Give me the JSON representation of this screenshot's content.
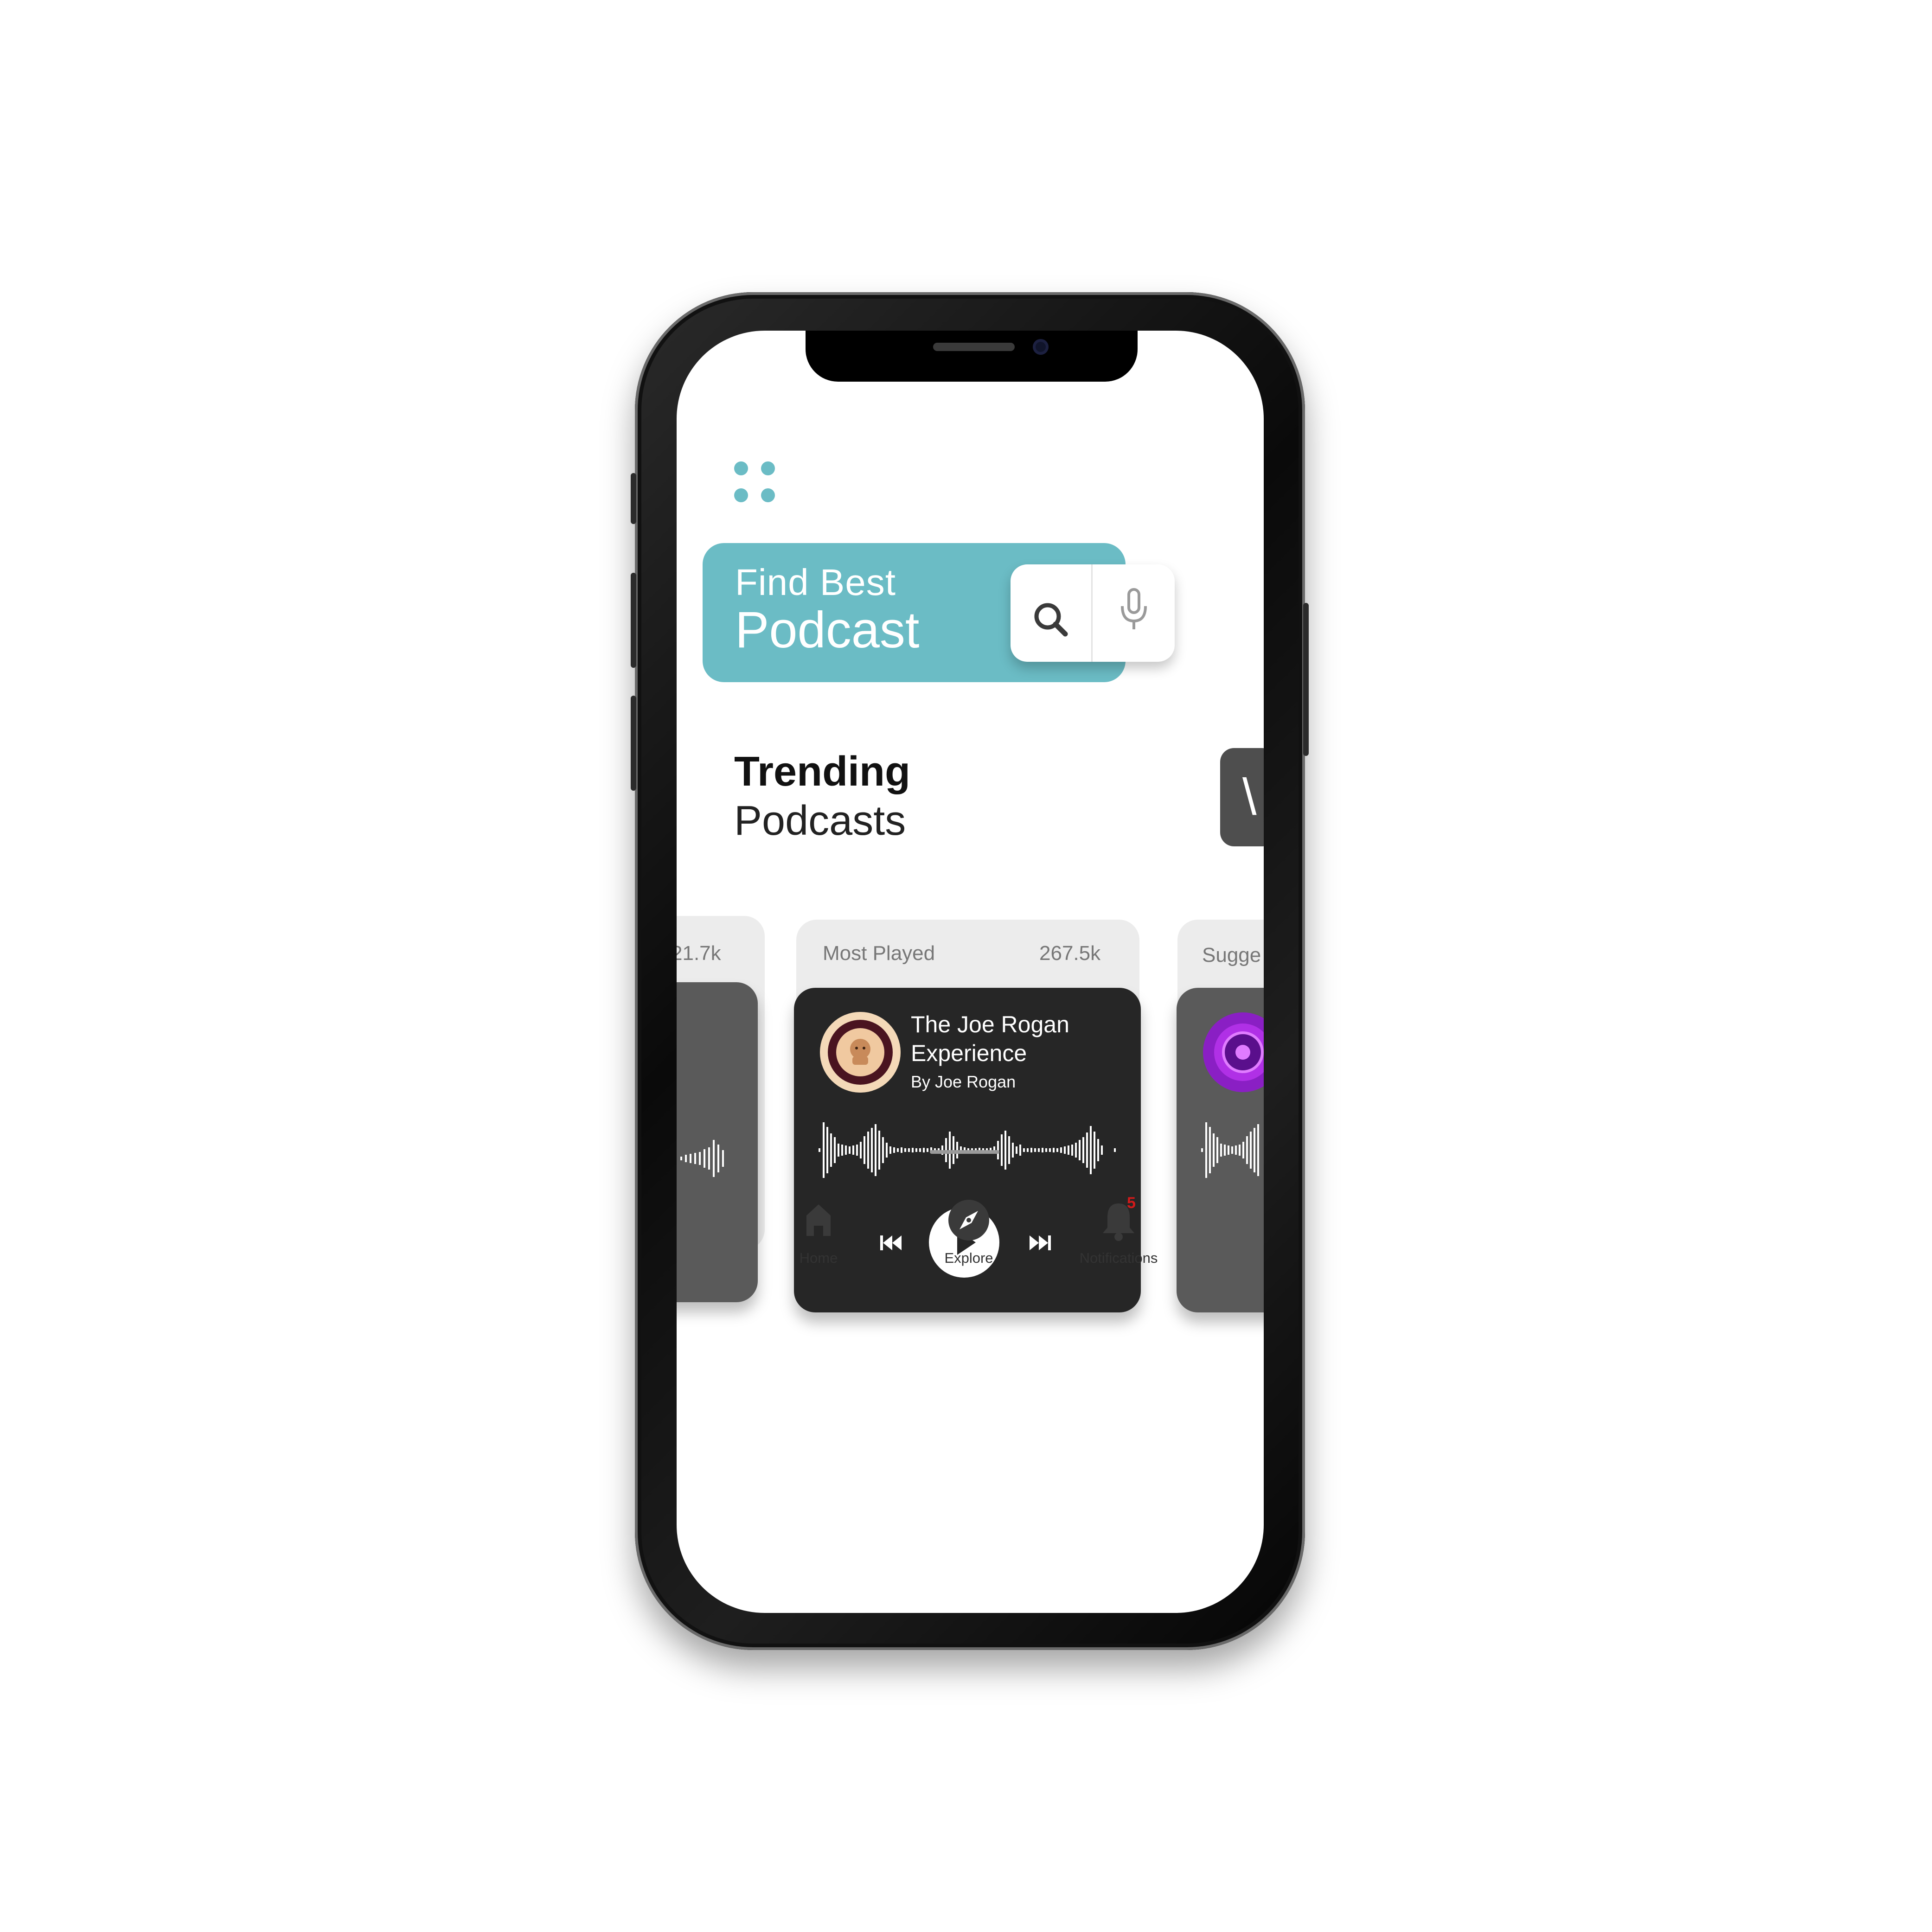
{
  "header": {
    "menu_icon": "grid-dots-icon",
    "search_line1": "Find Best",
    "search_line2": "Podcast",
    "search_icon": "search-icon",
    "mic_icon": "microphone-icon"
  },
  "section": {
    "title_bold": "Trending",
    "title_light": "Podcasts",
    "view_chip_glyph": "\\"
  },
  "cards": {
    "left": {
      "count": "21.7k"
    },
    "center": {
      "category": "Most Played",
      "count": "267.5k",
      "title": "The Joe Rogan Experience",
      "author": "By Joe Rogan"
    },
    "right": {
      "category": "Sugge"
    }
  },
  "player": {
    "prev_icon": "skip-previous-icon",
    "play_icon": "play-icon",
    "next_icon": "skip-next-icon"
  },
  "nav": {
    "items": [
      {
        "label": "Home",
        "icon": "home-icon"
      },
      {
        "label": "Explore",
        "icon": "compass-icon"
      },
      {
        "label": "Notifications",
        "icon": "bell-icon"
      }
    ],
    "notification_badge": "5"
  },
  "colors": {
    "accent": "#6bbcc5",
    "card_dark": "#262626",
    "card_gray": "#5a5a5a",
    "badge": "#d11a1a"
  }
}
